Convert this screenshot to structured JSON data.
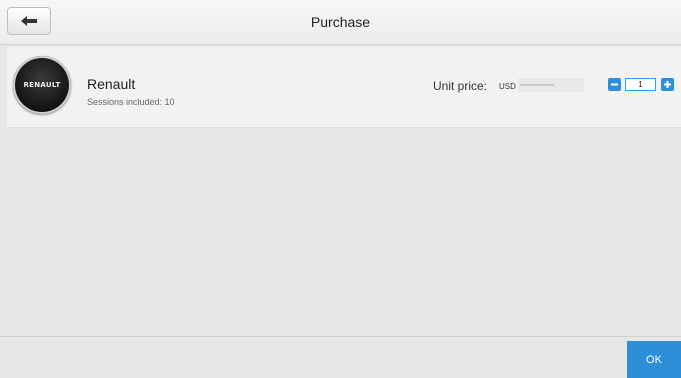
{
  "header": {
    "title": "Purchase",
    "back_icon": "arrow-left-icon"
  },
  "product": {
    "brand_name": "Renault",
    "logo_text": "RENAULT",
    "sessions_text": "Sessions included: 10",
    "unit_price_label": "Unit price:",
    "currency": "USD",
    "quantity": "1",
    "minus_icon": "minus-icon",
    "plus_icon": "plus-icon"
  },
  "footer": {
    "ok_label": "OK"
  },
  "colors": {
    "accent": "#2d8fd8",
    "background": "#e6e6e6",
    "row_background": "#f2f2f2"
  }
}
